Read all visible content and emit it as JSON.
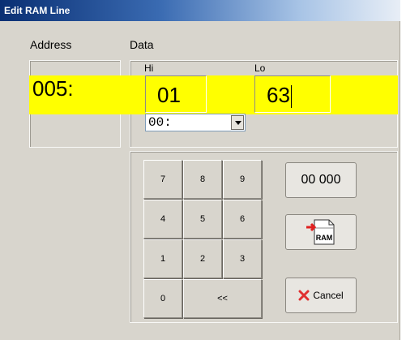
{
  "window": {
    "title": "Edit RAM Line"
  },
  "labels": {
    "address": "Address",
    "data": "Data",
    "hi": "Hi",
    "lo": "Lo"
  },
  "address": {
    "value": "005:"
  },
  "hi": {
    "value": "01"
  },
  "lo": {
    "value": "63"
  },
  "combo": {
    "selected": "00:"
  },
  "keypad": {
    "keys": [
      "7",
      "8",
      "9",
      "4",
      "5",
      "6",
      "1",
      "2",
      "3",
      "0",
      "<<"
    ]
  },
  "buttons": {
    "zero_label": "00 000",
    "ram_icon_text": "RAM",
    "cancel_label": "Cancel"
  },
  "colors": {
    "highlight": "#ffff00",
    "dialog_bg": "#d8d5cd",
    "title_bar": "#0a2f73",
    "cancel_icon": "#e03030"
  }
}
